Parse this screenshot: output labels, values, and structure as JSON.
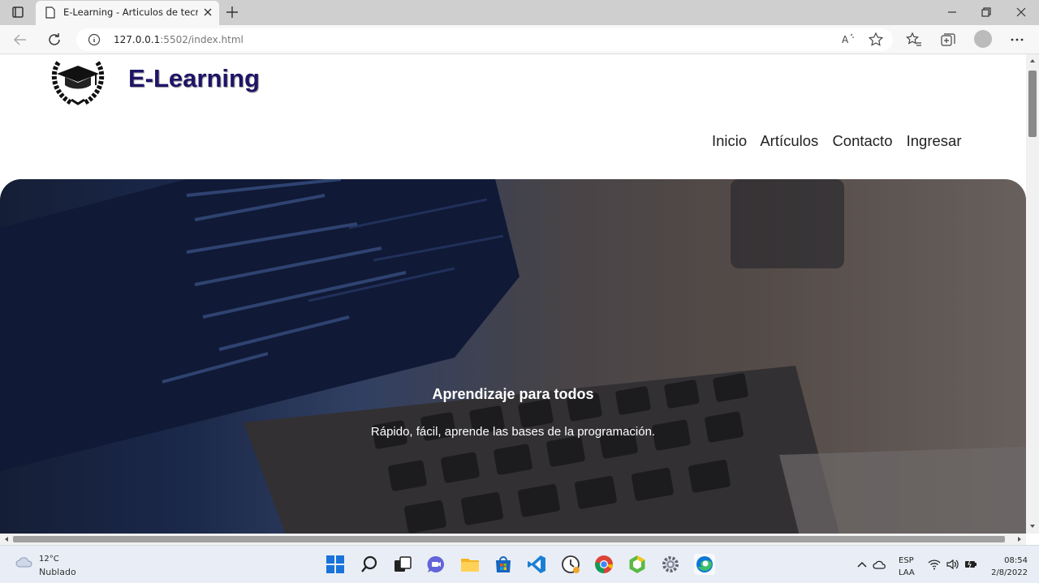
{
  "browser": {
    "tab_title": "E-Learning - Articulos de tecnolo",
    "url_host": "127.0.0.1",
    "url_rest": ":5502/index.html"
  },
  "site": {
    "brand": "E-Learning",
    "nav": [
      "Inicio",
      "Artículos",
      "Contacto",
      "Ingresar"
    ]
  },
  "hero": {
    "title": "Aprendizaje para todos",
    "subtitle": "Rápido, fácil, aprende las bases de la programación."
  },
  "taskbar": {
    "temperature": "12°C",
    "weather": "Nublado",
    "lang_line1": "ESP",
    "lang_line2": "LAA",
    "time": "08:54",
    "date": "2/8/2022"
  }
}
